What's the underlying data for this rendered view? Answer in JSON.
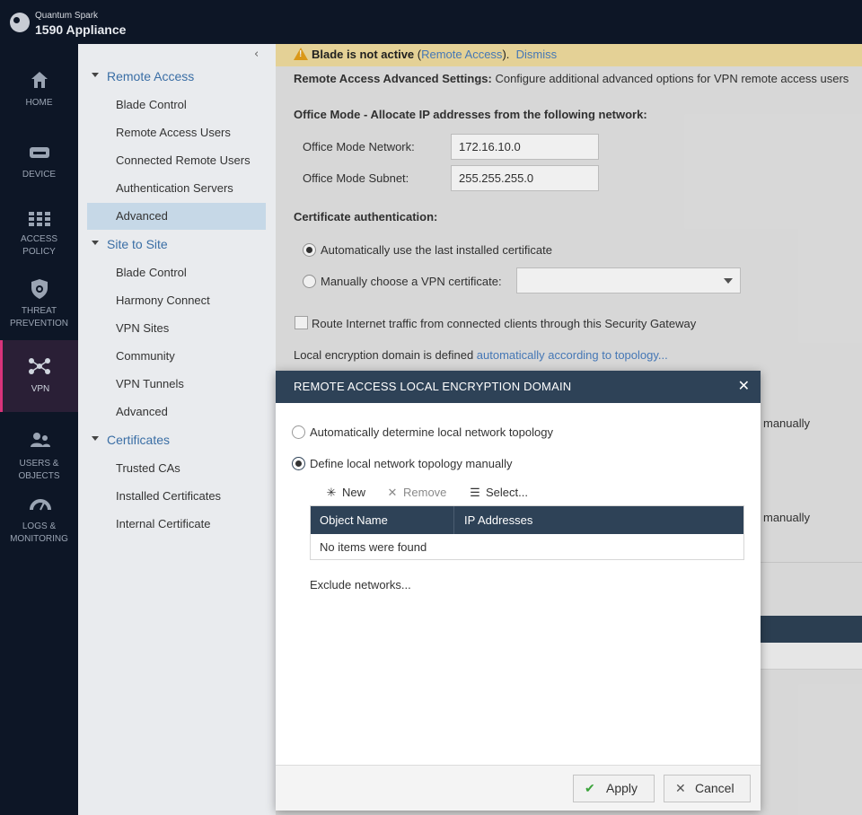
{
  "header": {
    "brand_line1": "Quantum Spark",
    "brand_line2": "1590 Appliance"
  },
  "rail": {
    "items": [
      {
        "label_lines": [
          "HOME"
        ],
        "icon": "home-icon"
      },
      {
        "label_lines": [
          "DEVICE"
        ],
        "icon": "device-icon"
      },
      {
        "label_lines": [
          "ACCESS",
          "POLICY"
        ],
        "icon": "access-policy-icon"
      },
      {
        "label_lines": [
          "THREAT",
          "PREVENTION"
        ],
        "icon": "shield-icon"
      },
      {
        "label_lines": [
          "VPN"
        ],
        "icon": "vpn-icon",
        "active": true
      },
      {
        "label_lines": [
          "USERS &",
          "OBJECTS"
        ],
        "icon": "users-icon"
      },
      {
        "label_lines": [
          "LOGS &",
          "MONITORING"
        ],
        "icon": "gauge-icon"
      }
    ]
  },
  "sidebar": {
    "collapse_icon": "chevron-left-icon",
    "sections": [
      {
        "title": "Remote Access",
        "items": [
          "Blade Control",
          "Remote Access Users",
          "Connected Remote Users",
          "Authentication Servers",
          "Advanced"
        ]
      },
      {
        "title": "Site to Site",
        "items": [
          "Blade Control",
          "Harmony Connect",
          "VPN Sites",
          "Community",
          "VPN Tunnels",
          "Advanced"
        ]
      },
      {
        "title": "Certificates",
        "items": [
          "Trusted CAs",
          "Installed Certificates",
          "Internal Certificate"
        ]
      }
    ],
    "selected": "Advanced"
  },
  "banner": {
    "text": "Blade is not active",
    "open_paren": " (",
    "link": "Remote Access",
    "close": ").",
    "dismiss": "Dismiss"
  },
  "main": {
    "intro_bold": "Remote Access Advanced Settings:",
    "intro_text": " Configure additional advanced options for VPN remote access users",
    "office_mode_heading": "Office Mode - Allocate IP addresses from the following network:",
    "office_mode_network_label": "Office Mode Network:",
    "office_mode_network_value": "172.16.10.0",
    "office_mode_subnet_label": "Office Mode Subnet:",
    "office_mode_subnet_value": "255.255.255.0",
    "cert_heading": "Certificate authentication:",
    "cert_option_auto": "Automatically use the last installed certificate",
    "cert_option_manual": "Manually choose a VPN certificate:",
    "route_internet": "Route Internet traffic from connected clients through this Security Gateway",
    "enc_domain_text": "Local encryption domain is defined ",
    "enc_domain_link": "automatically according to topology...",
    "bg_link_manually_1": "manually",
    "bg_link_manually_2": "manually"
  },
  "modal": {
    "title": "REMOTE ACCESS LOCAL ENCRYPTION DOMAIN",
    "option_auto": "Automatically determine local network topology",
    "option_manual": "Define local network topology manually",
    "toolbar": {
      "new": "New",
      "remove": "Remove",
      "select": "Select..."
    },
    "table": {
      "columns": [
        "Object Name",
        "IP Addresses"
      ],
      "empty": "No items were found"
    },
    "exclude_link": "Exclude networks...",
    "apply": "Apply",
    "cancel": "Cancel"
  },
  "colors": {
    "accent": "#d8337a",
    "link": "#4a7fc1",
    "header_dark": "#2e4257",
    "banner": "#f3dfa0"
  }
}
